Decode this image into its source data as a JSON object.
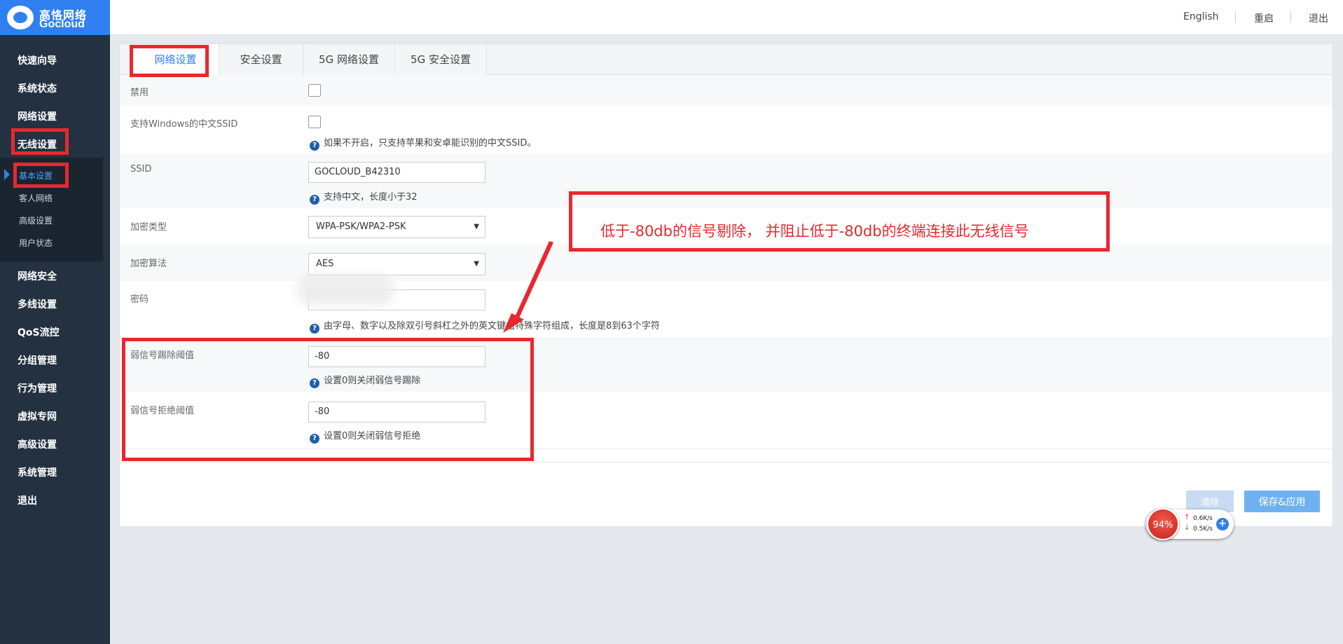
{
  "brand": {
    "name_cn": "高恪网络",
    "name_en": "Gocloud"
  },
  "topbar": {
    "links": [
      "English",
      "重启",
      "退出"
    ]
  },
  "sidebar": {
    "items": [
      "快速向导",
      "系统状态",
      "网络设置",
      "无线设置",
      "网络安全",
      "多线设置",
      "QoS流控",
      "分组管理",
      "行为管理",
      "虚拟专网",
      "高级设置",
      "系统管理",
      "退出"
    ],
    "submenu": [
      "基本设置",
      "客人网络",
      "高级设置",
      "用户状态"
    ],
    "active_submenu": "基本设置"
  },
  "tabs": [
    "网络设置",
    "安全设置",
    "5G 网络设置",
    "5G 安全设置"
  ],
  "form": {
    "disable_label": "禁用",
    "cn_ssid_label": "支持Windows的中文SSID",
    "cn_ssid_hint": "如果不开启，只支持苹果和安卓能识别的中文SSID。",
    "ssid_label": "SSID",
    "ssid_value": "GOCLOUD_B42310",
    "ssid_hint": "支持中文，长度小于32",
    "enc_type_label": "加密类型",
    "enc_type_value": "WPA-PSK/WPA2-PSK",
    "enc_alg_label": "加密算法",
    "enc_alg_value": "AES",
    "password_label": "密码",
    "password_hint": "由字母、数字以及除双引号斜杠之外的英文键盘特殊字符组成，长度是8到63个字符",
    "kick_label": "弱信号踢除阈值",
    "kick_value": "-80",
    "kick_hint": "设置0则关闭弱信号踢除",
    "reject_label": "弱信号拒绝阈值",
    "reject_value": "-80",
    "reject_hint": "设置0则关闭弱信号拒绝",
    "hint_icon": "?"
  },
  "buttons": {
    "clear": "清除",
    "save": "保存&应用"
  },
  "annotation": {
    "text": "低于-80db的信号剔除， 并阻止低于-80db的终端连接此无线信号",
    "color": "#e8282e"
  },
  "speed_widget": {
    "percent": "94%",
    "up": "0.6K/s",
    "down": "0.5K/s"
  }
}
